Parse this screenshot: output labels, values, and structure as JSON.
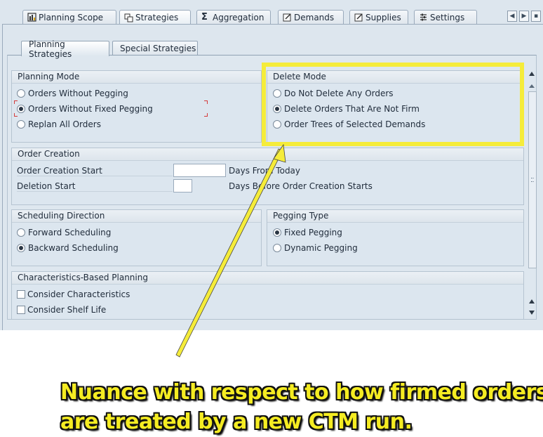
{
  "top_tabs": [
    {
      "label": "Planning Scope",
      "icon": "planning-scope-icon"
    },
    {
      "label": "Strategies",
      "icon": "strategies-icon",
      "active": true
    },
    {
      "label": "Aggregation",
      "icon": "sigma-icon"
    },
    {
      "label": "Demands",
      "icon": "demands-icon"
    },
    {
      "label": "Supplies",
      "icon": "supplies-icon"
    },
    {
      "label": "Settings",
      "icon": "settings-icon"
    }
  ],
  "sub_tabs": [
    {
      "label": "Planning Strategies",
      "active": true
    },
    {
      "label": "Special Strategies"
    }
  ],
  "planning_mode": {
    "title": "Planning Mode",
    "options": [
      {
        "label": "Orders Without Pegging",
        "selected": false
      },
      {
        "label": "Orders Without Fixed Pegging",
        "selected": true
      },
      {
        "label": "Replan All Orders",
        "selected": false
      }
    ]
  },
  "delete_mode": {
    "title": "Delete Mode",
    "options": [
      {
        "label": "Do Not Delete Any Orders",
        "selected": false
      },
      {
        "label": "Delete Orders That Are Not Firm",
        "selected": true
      },
      {
        "label": "Order Trees of Selected Demands",
        "selected": false
      }
    ]
  },
  "order_creation": {
    "title": "Order Creation",
    "start_label": "Order Creation Start",
    "start_value": "",
    "start_suffix": "Days From Today",
    "deletion_label": "Deletion Start",
    "deletion_value": "",
    "deletion_suffix": "Days Before Order Creation Starts"
  },
  "scheduling_direction": {
    "title": "Scheduling Direction",
    "options": [
      {
        "label": "Forward Scheduling",
        "selected": false
      },
      {
        "label": "Backward Scheduling",
        "selected": true
      }
    ]
  },
  "pegging_type": {
    "title": "Pegging Type",
    "options": [
      {
        "label": "Fixed Pegging",
        "selected": true
      },
      {
        "label": "Dynamic Pegging",
        "selected": false
      }
    ]
  },
  "characteristics": {
    "title": "Characteristics-Based Planning",
    "options": [
      {
        "label": "Consider Characteristics",
        "checked": false
      },
      {
        "label": "Consider Shelf Life",
        "checked": false
      }
    ]
  },
  "annotation": {
    "line1": "Nuance with respect to how firmed orders",
    "line2": "are treated by a new CTM run.",
    "highlight_color": "#f5ec3a"
  },
  "colors": {
    "panel": "#dde6ee",
    "border": "#9aaabb"
  }
}
